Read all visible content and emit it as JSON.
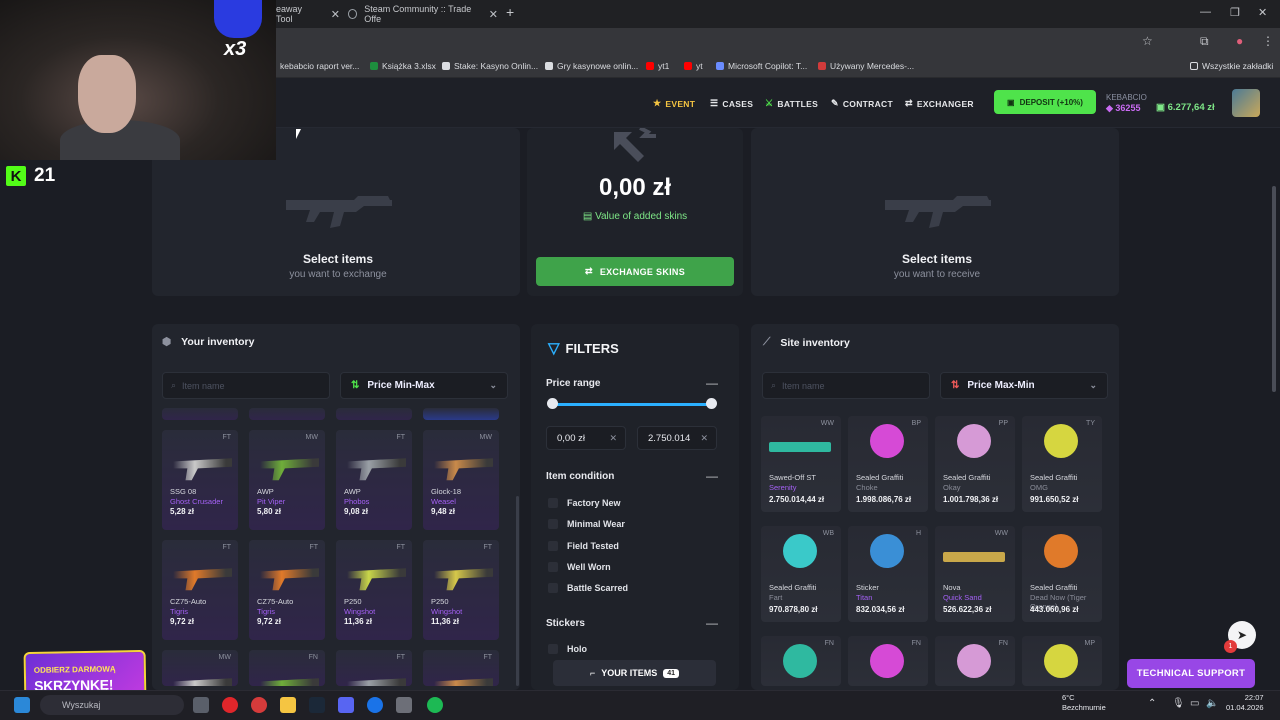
{
  "browser": {
    "tabs": [
      {
        "label": "eaway Tool"
      },
      {
        "label": "Steam Community :: Trade Offe"
      }
    ],
    "bookmarks": [
      "kebabcio raport ver...",
      "Książka 3.xlsx",
      "Stake: Kasyno Onlin...",
      "Gry kasynowe onlin...",
      "yt1",
      "yt",
      "Microsoft Copilot: T...",
      "Używany Mercedes-..."
    ],
    "all_bookmarks": "Wszystkie zakładki"
  },
  "nav": {
    "event": "EVENT",
    "cases": "CASES",
    "battles": "BATTLES",
    "contract": "CONTRACT",
    "exchanger": "EXCHANGER",
    "deposit": "DEPOSIT (+10%)",
    "username": "KEBABCIO",
    "gems": "36255",
    "balance": "6.277,64 zł"
  },
  "exchange": {
    "left_title": "Select items",
    "left_sub": "you want to exchange",
    "value": "0,00 zł",
    "value_label": "Value of added skins",
    "button": "EXCHANGE SKINS",
    "right_title": "Select items",
    "right_sub": "you want to receive"
  },
  "your_inventory": {
    "title": "Your inventory",
    "search_placeholder": "Item name",
    "sort": "Price Min-Max",
    "items": [
      {
        "wear": "FT",
        "name": "SSG 08",
        "skin": "Ghost Crusader",
        "price": "5,28 zł"
      },
      {
        "wear": "MW",
        "name": "AWP",
        "skin": "Pit Viper",
        "price": "5,80 zł"
      },
      {
        "wear": "FT",
        "name": "AWP",
        "skin": "Phobos",
        "price": "9,08 zł"
      },
      {
        "wear": "MW",
        "name": "Glock-18",
        "skin": "Weasel",
        "price": "9,48 zł"
      },
      {
        "wear": "FT",
        "name": "CZ75-Auto",
        "skin": "Tigris",
        "price": "9,72 zł"
      },
      {
        "wear": "FT",
        "name": "CZ75-Auto",
        "skin": "Tigris",
        "price": "9,72 zł"
      },
      {
        "wear": "FT",
        "name": "P250",
        "skin": "Wingshot",
        "price": "11,36 zł"
      },
      {
        "wear": "FT",
        "name": "P250",
        "skin": "Wingshot",
        "price": "11,36 zł"
      }
    ],
    "row3_wears": [
      "MW",
      "FN",
      "FT",
      "FT"
    ]
  },
  "filters": {
    "title": "FILTERS",
    "price_range": "Price range",
    "min": "0,00 zł",
    "max": "2.750.014",
    "item_condition": "Item condition",
    "conditions": [
      "Factory New",
      "Minimal Wear",
      "Field Tested",
      "Well Worn",
      "Battle Scarred"
    ],
    "stickers": "Stickers",
    "holo": "Holo",
    "your_items": "YOUR ITEMS",
    "your_items_count": "41"
  },
  "site_inventory": {
    "title": "Site inventory",
    "search_placeholder": "Item name",
    "sort": "Price Max-Min",
    "items": [
      {
        "wear": "WW",
        "name": "Sawed-Off ST",
        "skin": "Serenity",
        "price": "2.750.014,44 zł"
      },
      {
        "wear": "BP",
        "name": "Sealed Graffiti",
        "skin": "Choke",
        "price": "1.998.086,76 zł"
      },
      {
        "wear": "PP",
        "name": "Sealed Graffiti",
        "skin": "Okay",
        "price": "1.001.798,36 zł"
      },
      {
        "wear": "TY",
        "name": "Sealed Graffiti",
        "skin": "OMG",
        "price": "991.650,52 zł"
      },
      {
        "wear": "WB",
        "name": "Sealed Graffiti",
        "skin": "Fart",
        "price": "970.878,80 zł"
      },
      {
        "wear": "H",
        "name": "Sticker",
        "skin": "Titan",
        "price": "832.034,56 zł"
      },
      {
        "wear": "WW",
        "name": "Nova",
        "skin": "Quick Sand",
        "price": "526.622,36 zł"
      },
      {
        "wear": "",
        "name": "Sealed Graffiti",
        "skin": "Dead Now (Tiger Orange)",
        "price": "443.060,96 zł"
      }
    ],
    "row3_wears": [
      "FN",
      "FN",
      "FN",
      "MP"
    ]
  },
  "support": "TECHNICAL SUPPORT",
  "support_badge": "1",
  "stream": {
    "multiplier": "x3",
    "kick_count": "21",
    "promo_l1": "ODBIERZ DARMOWĄ",
    "promo_l2": "SKRZYNKĘ!"
  },
  "taskbar": {
    "search": "Wyszukaj",
    "temp": "6°C",
    "weather": "Bezchmurnie",
    "time": "22:07",
    "date": "01.04.2026"
  }
}
